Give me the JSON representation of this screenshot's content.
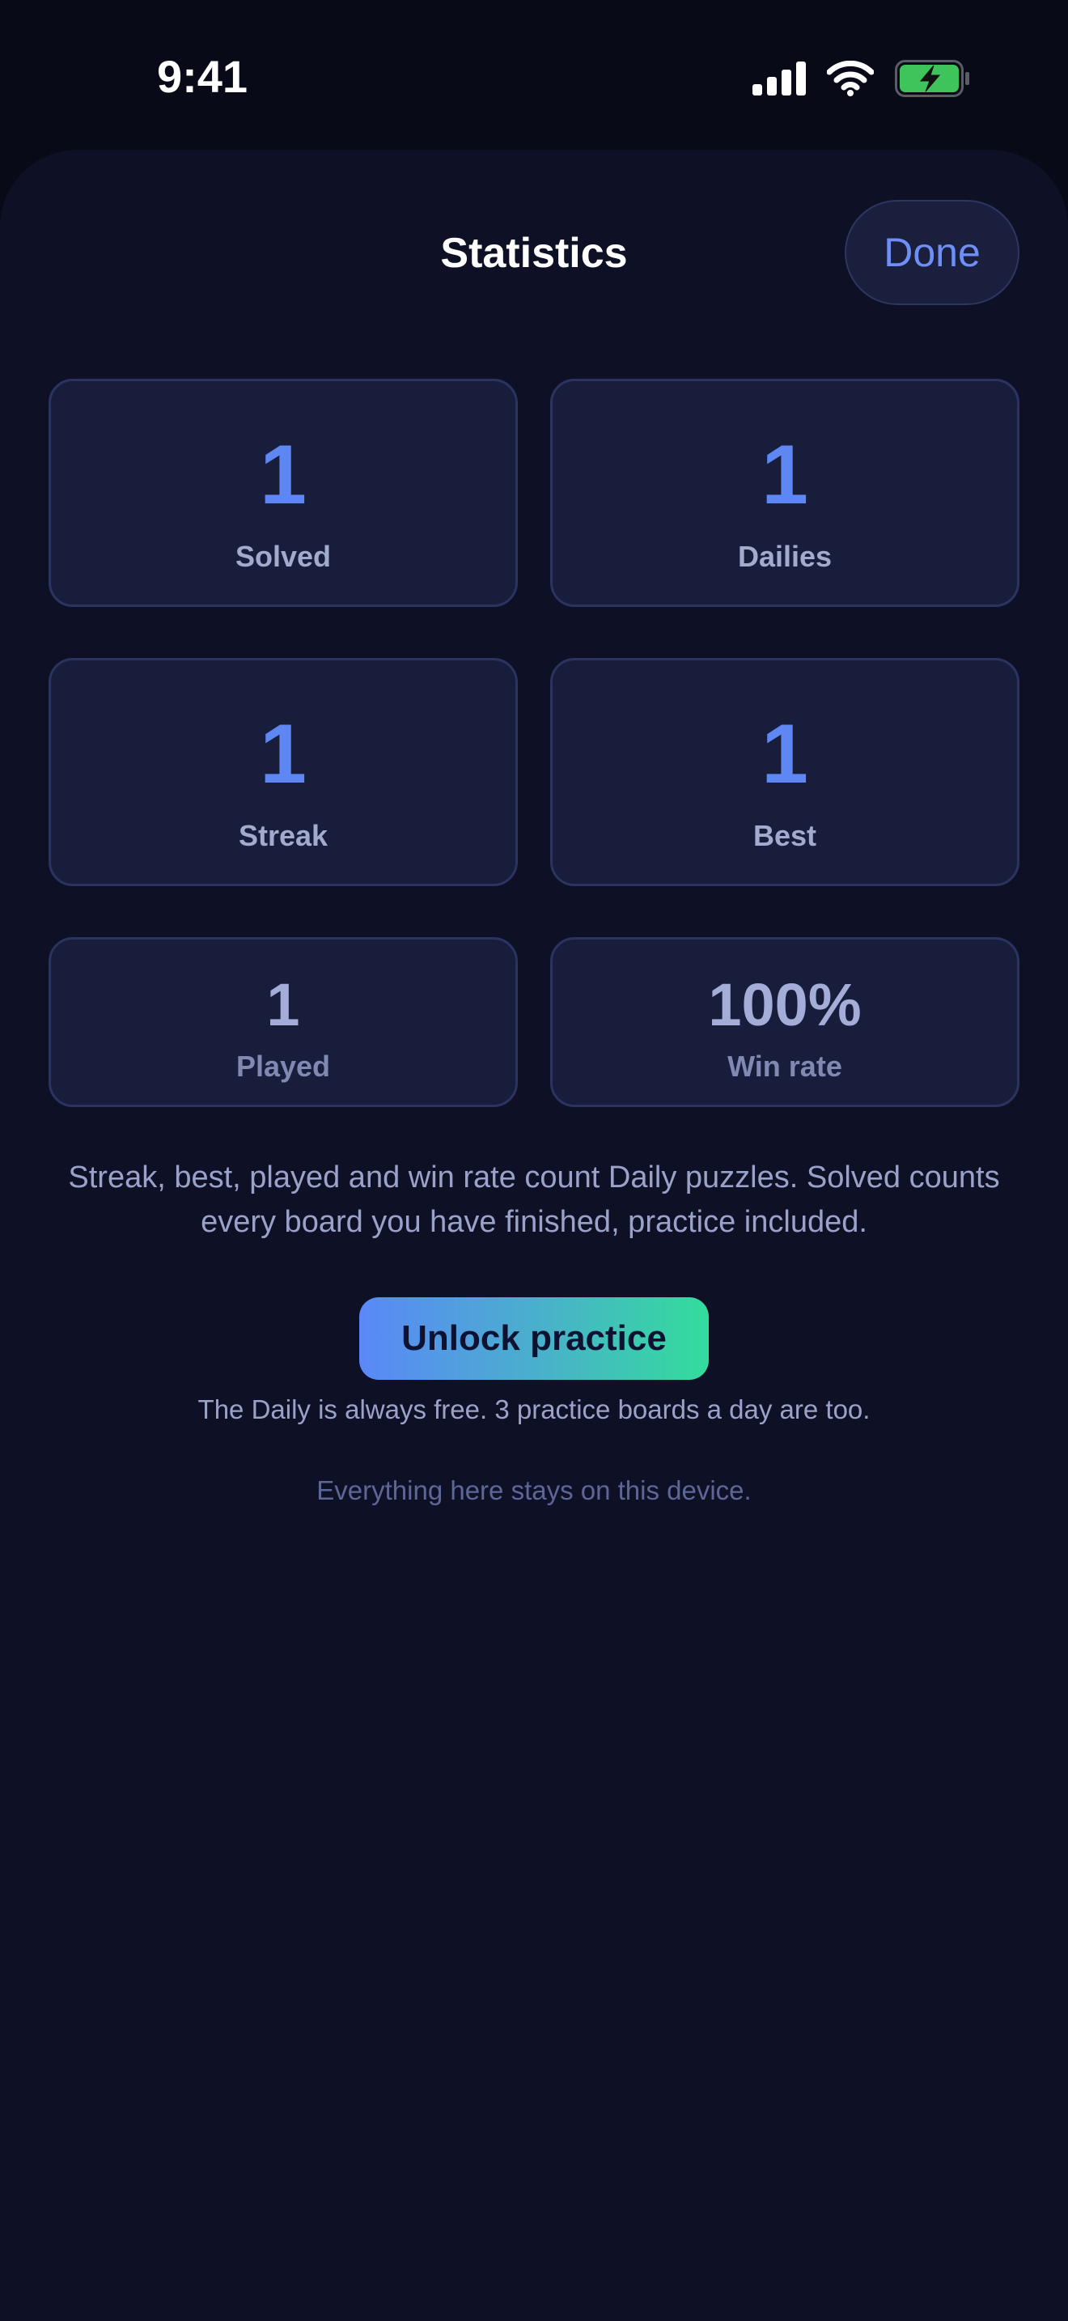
{
  "status_bar": {
    "time": "9:41",
    "icons": [
      "cellular-signal-icon",
      "wifi-icon",
      "battery-charging-icon"
    ],
    "battery_color": "#3ec45a"
  },
  "sheet": {
    "title": "Statistics",
    "done_label": "Done"
  },
  "stats": [
    {
      "value": "1",
      "label": "Solved"
    },
    {
      "value": "1",
      "label": "Dailies"
    },
    {
      "value": "1",
      "label": "Streak"
    },
    {
      "value": "1",
      "label": "Best"
    },
    {
      "value": "1",
      "label": "Played"
    },
    {
      "value": "100%",
      "label": "Win rate"
    }
  ],
  "note": "Streak, best, played and win rate count Daily puzzles. Solved counts every board you have finished, practice included.",
  "unlock": {
    "label": "Unlock practice",
    "gradient_start": "#5a88f8",
    "gradient_end": "#33dc9c"
  },
  "free_note": "The Daily is always free. 3 practice boards a day are too.",
  "device_note": "Everything here stays on this device.",
  "colors": {
    "background": "#0e1126",
    "card": "#181d3b",
    "accent": "#5f87f4"
  }
}
